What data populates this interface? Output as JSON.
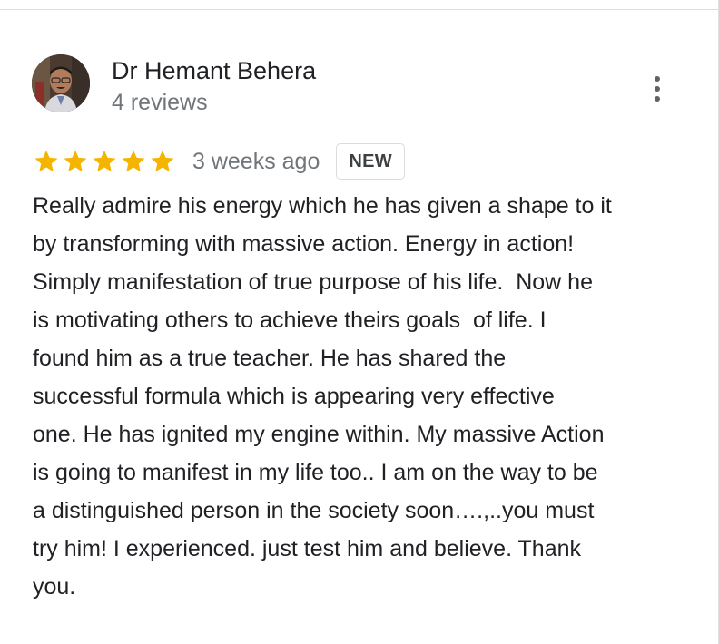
{
  "reviewer": {
    "name": "Dr Hemant Behera",
    "review_count": "4 reviews",
    "avatar_icon": "person-photo-avatar"
  },
  "menu": {
    "icon": "more-vert-icon"
  },
  "rating": {
    "stars": 5,
    "max_stars": 5,
    "star_color": "#f4b400",
    "time": "3 weeks ago",
    "badge": "NEW"
  },
  "review": {
    "lines": [
      "Really admire his energy which he has given a shape to it",
      "by transforming with massive action. Energy in action!",
      "Simply manifestation of true purpose of his life.  Now he",
      "is motivating others to achieve theirs goals  of life. I",
      "found him as a true teacher. He has shared the",
      "successful formula which is appearing very effective",
      "one. He has ignited my engine within. My massive Action",
      "is going to manifest in my life too.. I am on the way to be",
      "a distinguished person in the society soon….,..you must",
      "try him! I experienced. just test him and believe. Thank",
      "you."
    ]
  },
  "colors": {
    "text_primary": "#202124",
    "text_secondary": "#70757a",
    "divider": "#dadce0"
  }
}
